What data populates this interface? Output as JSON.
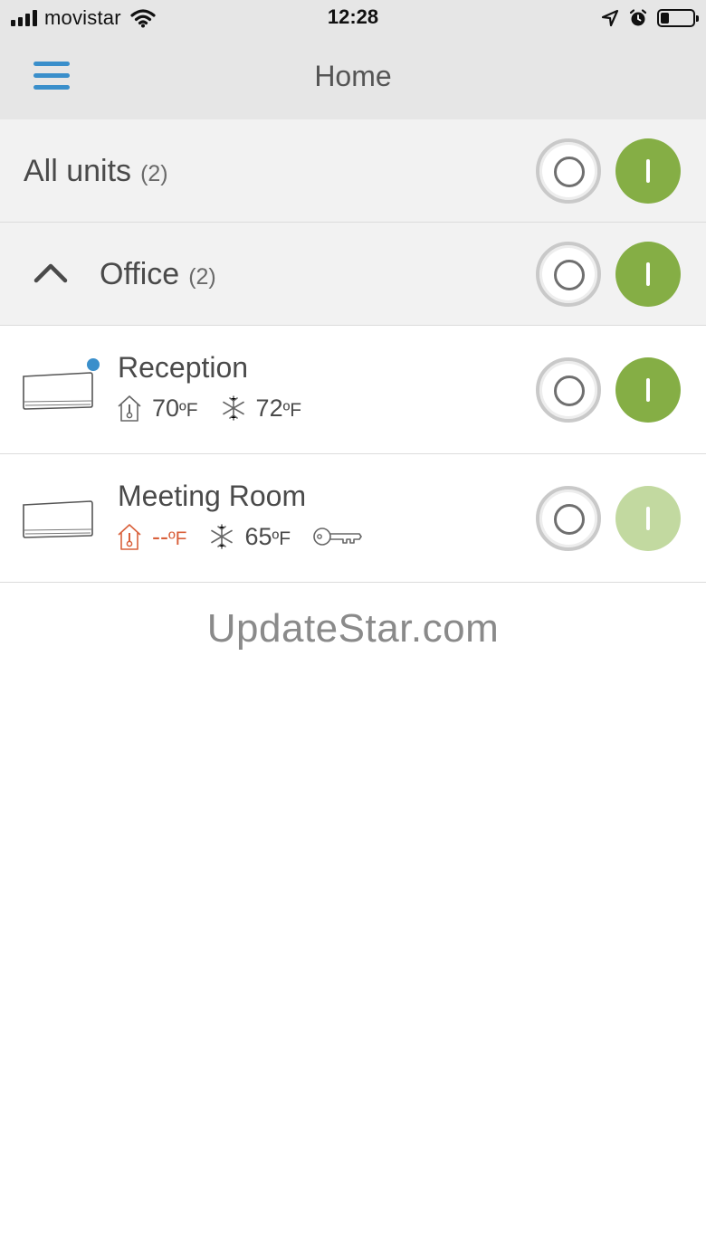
{
  "status_bar": {
    "carrier": "movistar",
    "time": "12:28",
    "battery_level": 0.25
  },
  "nav": {
    "title": "Home",
    "menu_icon": "hamburger-menu-icon"
  },
  "all_units": {
    "label": "All units",
    "count": "(2)"
  },
  "group": {
    "label": "Office",
    "count": "(2)"
  },
  "units": [
    {
      "name": "Reception",
      "room_temp": "70",
      "room_unit": "ºF",
      "set_temp": "72",
      "set_unit": "ºF",
      "mode": "cool",
      "power_on": true,
      "notification": true
    },
    {
      "name": "Meeting Room",
      "room_temp": "--",
      "room_unit": "ºF",
      "set_temp": "65",
      "set_unit": "ºF",
      "mode": "cool",
      "locked": true,
      "power_on": false
    }
  ],
  "watermark": "UpdateStar.com",
  "colors": {
    "accent": "#3a8fcb",
    "on_green": "#85ae45",
    "on_green_inactive": "#c2d9a0",
    "alert": "#d9603b"
  }
}
